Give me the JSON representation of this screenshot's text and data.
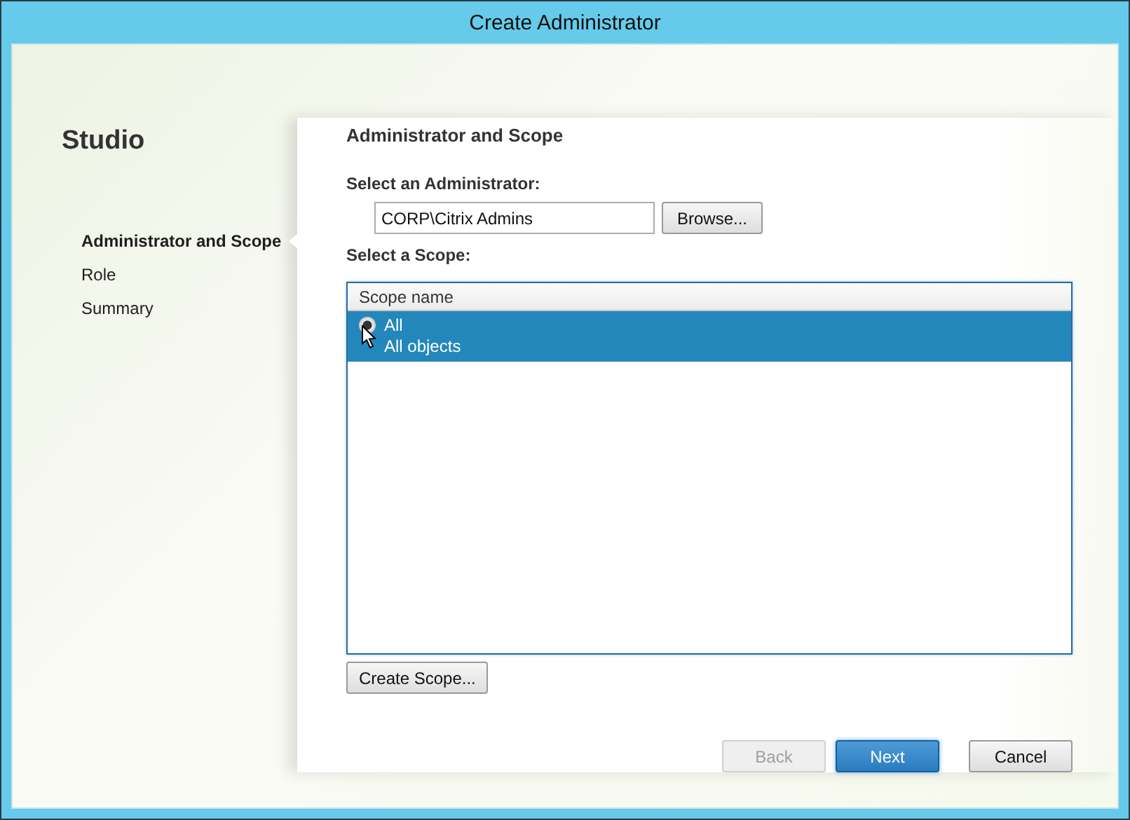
{
  "window": {
    "title": "Create Administrator"
  },
  "sidebar": {
    "brand": "Studio",
    "steps": [
      {
        "label": "Administrator and Scope",
        "selected": true
      },
      {
        "label": "Role",
        "selected": false
      },
      {
        "label": "Summary",
        "selected": false
      }
    ]
  },
  "page": {
    "heading": "Administrator and Scope",
    "admin_label": "Select an Administrator:",
    "admin_value": "CORP\\Citrix Admins",
    "browse_button": "Browse...",
    "scope_label": "Select a Scope:",
    "table": {
      "columns": [
        "Scope name"
      ],
      "rows": [
        {
          "name": "All",
          "description": "All objects",
          "selected": true
        }
      ]
    },
    "create_scope_button": "Create Scope..."
  },
  "buttons": [
    {
      "label": "Back",
      "disabled": true,
      "default": false
    },
    {
      "label": "Next",
      "disabled": false,
      "default": true
    },
    {
      "label": "Cancel",
      "disabled": false,
      "default": false
    }
  ]
}
